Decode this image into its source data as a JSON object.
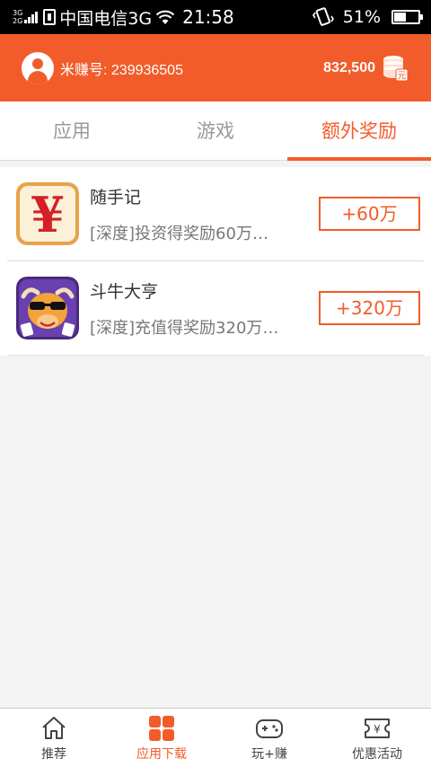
{
  "status_bar": {
    "net_top": "3G",
    "net_bottom": "2G",
    "carrier": "中国电信3G",
    "time": "21:58",
    "battery": "51%",
    "battery_level": 0.51
  },
  "header": {
    "user_id": "米赚号: 239936505",
    "coins": "832,500",
    "coin_badge": "元"
  },
  "tabs": [
    {
      "label": "应用",
      "active": false
    },
    {
      "label": "游戏",
      "active": false
    },
    {
      "label": "额外奖励",
      "active": true
    }
  ],
  "items": [
    {
      "name": "随手记",
      "desc": "[深度]投资得奖励60万…",
      "reward": "+60万",
      "icon": "yuan-app-icon",
      "icon_glyph": "¥"
    },
    {
      "name": "斗牛大亨",
      "desc": "[深度]充值得奖励320万…",
      "reward": "+320万",
      "icon": "bull-app-icon"
    }
  ],
  "bottom_nav": [
    {
      "label": "推荐",
      "icon": "home-icon",
      "active": false
    },
    {
      "label": "应用下载",
      "icon": "grid-icon",
      "active": true
    },
    {
      "label": "玩+赚",
      "icon": "gamepad-icon",
      "active": false
    },
    {
      "label": "优惠活动",
      "icon": "coupon-icon",
      "active": false,
      "glyph": "¥"
    }
  ],
  "colors": {
    "accent": "#f25c2a",
    "background": "#f3f3f3"
  }
}
